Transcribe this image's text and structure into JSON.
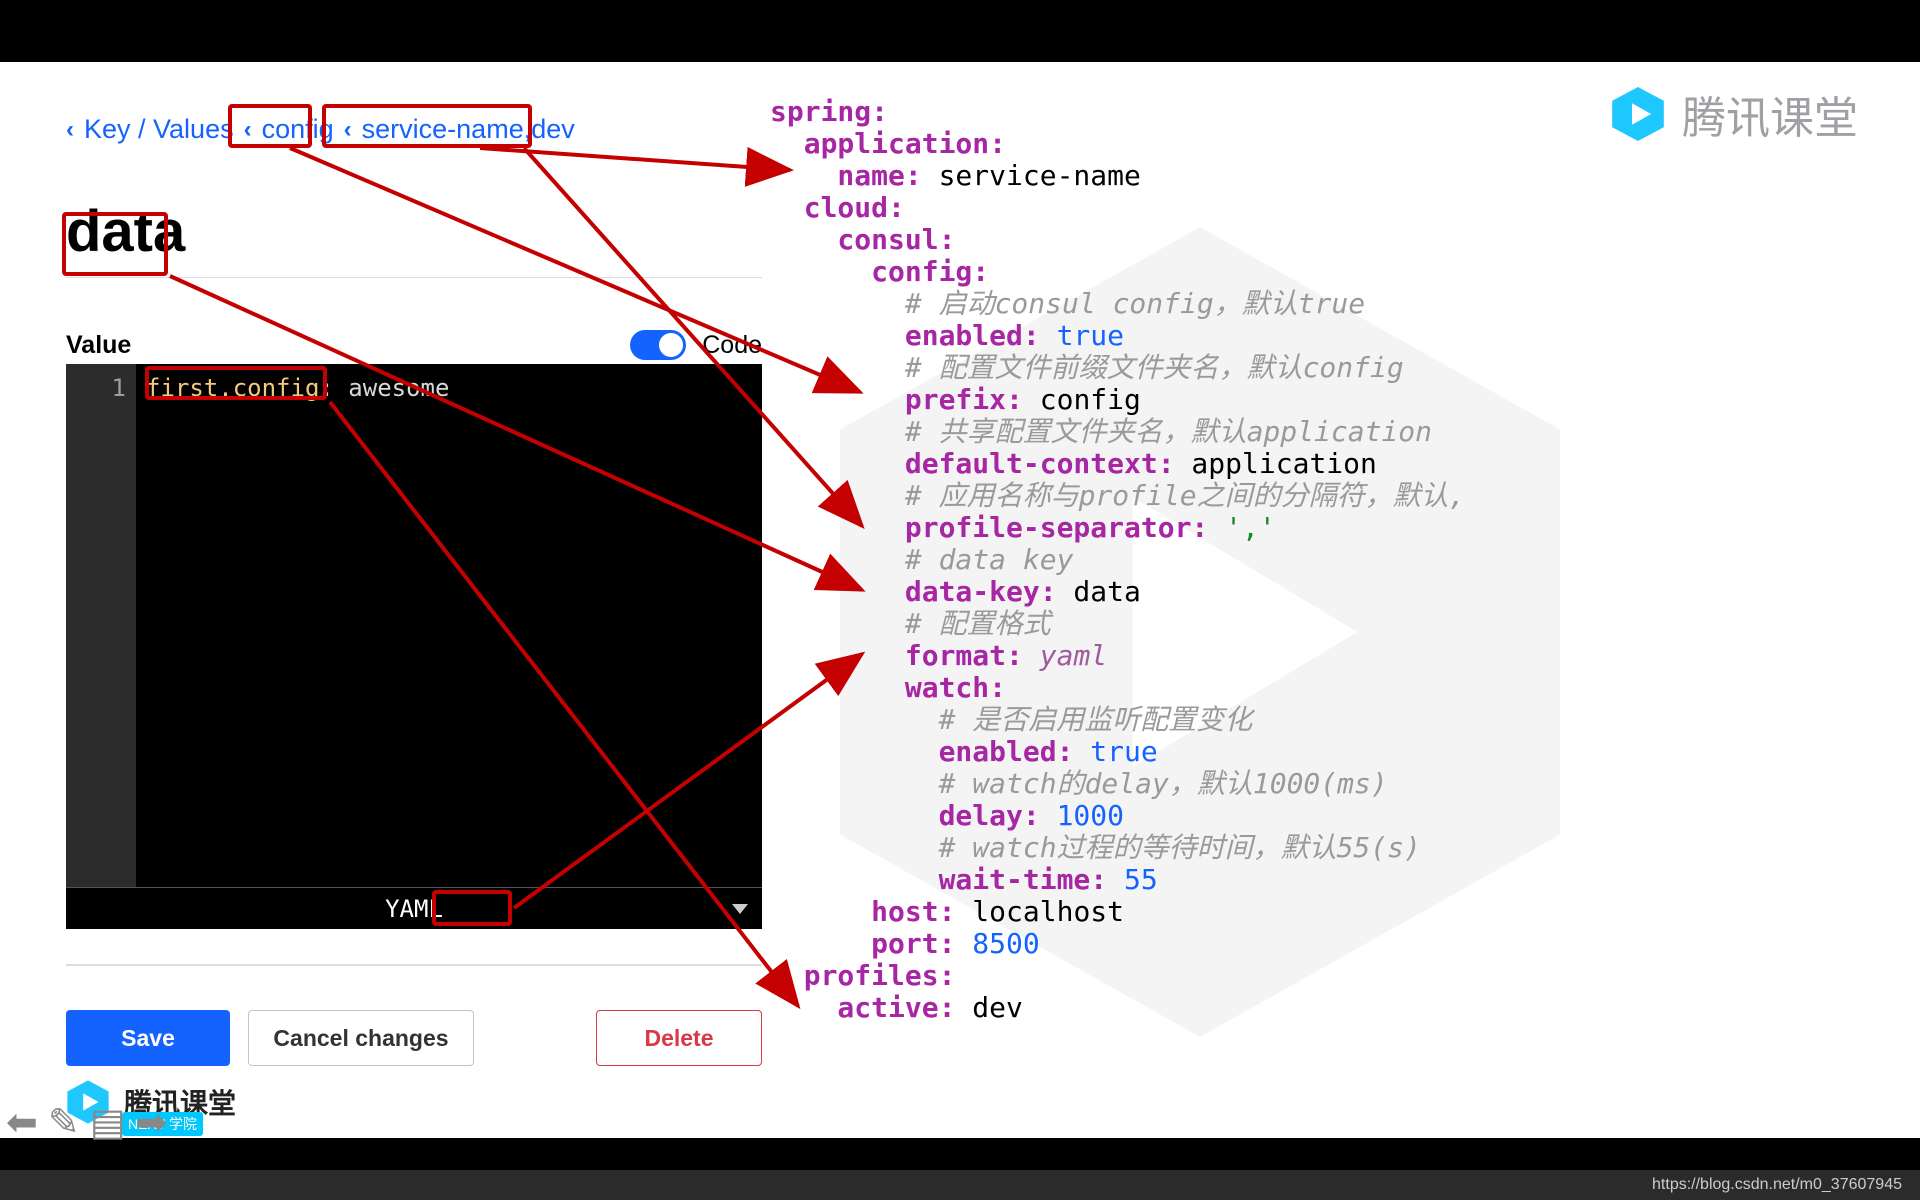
{
  "breadcrumb": {
    "root": "Key / Values",
    "seg1": "config",
    "seg2": "service-name,dev"
  },
  "title": "data",
  "panel": {
    "value_label": "Value",
    "code_label": "Code",
    "toggle_on": true,
    "line_number": "1",
    "line_key": "first.config",
    "line_val": "awesome",
    "lang_label": "YAML"
  },
  "buttons": {
    "save": "Save",
    "cancel": "Cancel changes",
    "delete": "Delete"
  },
  "yaml": {
    "spring": "spring:",
    "application": "  application:",
    "name_k": "    name:",
    "name_v": " service-name",
    "cloud": "  cloud:",
    "consul": "    consul:",
    "config": "      config:",
    "c1": "        # 启动consul config，默认true",
    "enabled_k": "        enabled:",
    "enabled_v": " true",
    "c2": "        # 配置文件前缀文件夹名，默认config",
    "prefix_k": "        prefix:",
    "prefix_v": " config",
    "c3": "        # 共享配置文件夹名，默认application",
    "dctx_k": "        default-context:",
    "dctx_v": " application",
    "c4": "        # 应用名称与profile之间的分隔符，默认,",
    "psep_k": "        profile-separator:",
    "psep_v": " ','",
    "c5": "        # data key",
    "dkey_k": "        data-key:",
    "dkey_v": " data",
    "c6": "        # 配置格式",
    "fmt_k": "        format:",
    "fmt_v": " yaml",
    "watch": "        watch:",
    "c7": "          # 是否启用监听配置变化",
    "wen_k": "          enabled:",
    "wen_v": " true",
    "c8": "          # watch的delay，默认1000(ms)",
    "delay_k": "          delay:",
    "delay_v": " 1000",
    "c9": "          # watch过程的等待时间，默认55(s)",
    "wait_k": "          wait-time:",
    "wait_v": " 55",
    "host_k": "      host:",
    "host_v": " localhost",
    "port_k": "      port:",
    "port_v": " 8500",
    "profiles": "  profiles:",
    "active_k": "    active:",
    "active_v": " dev"
  },
  "watermark": {
    "brand": "腾讯课堂",
    "next": "NEXT 学院"
  },
  "footer": {
    "url": "https://blog.csdn.net/m0_37607945"
  }
}
